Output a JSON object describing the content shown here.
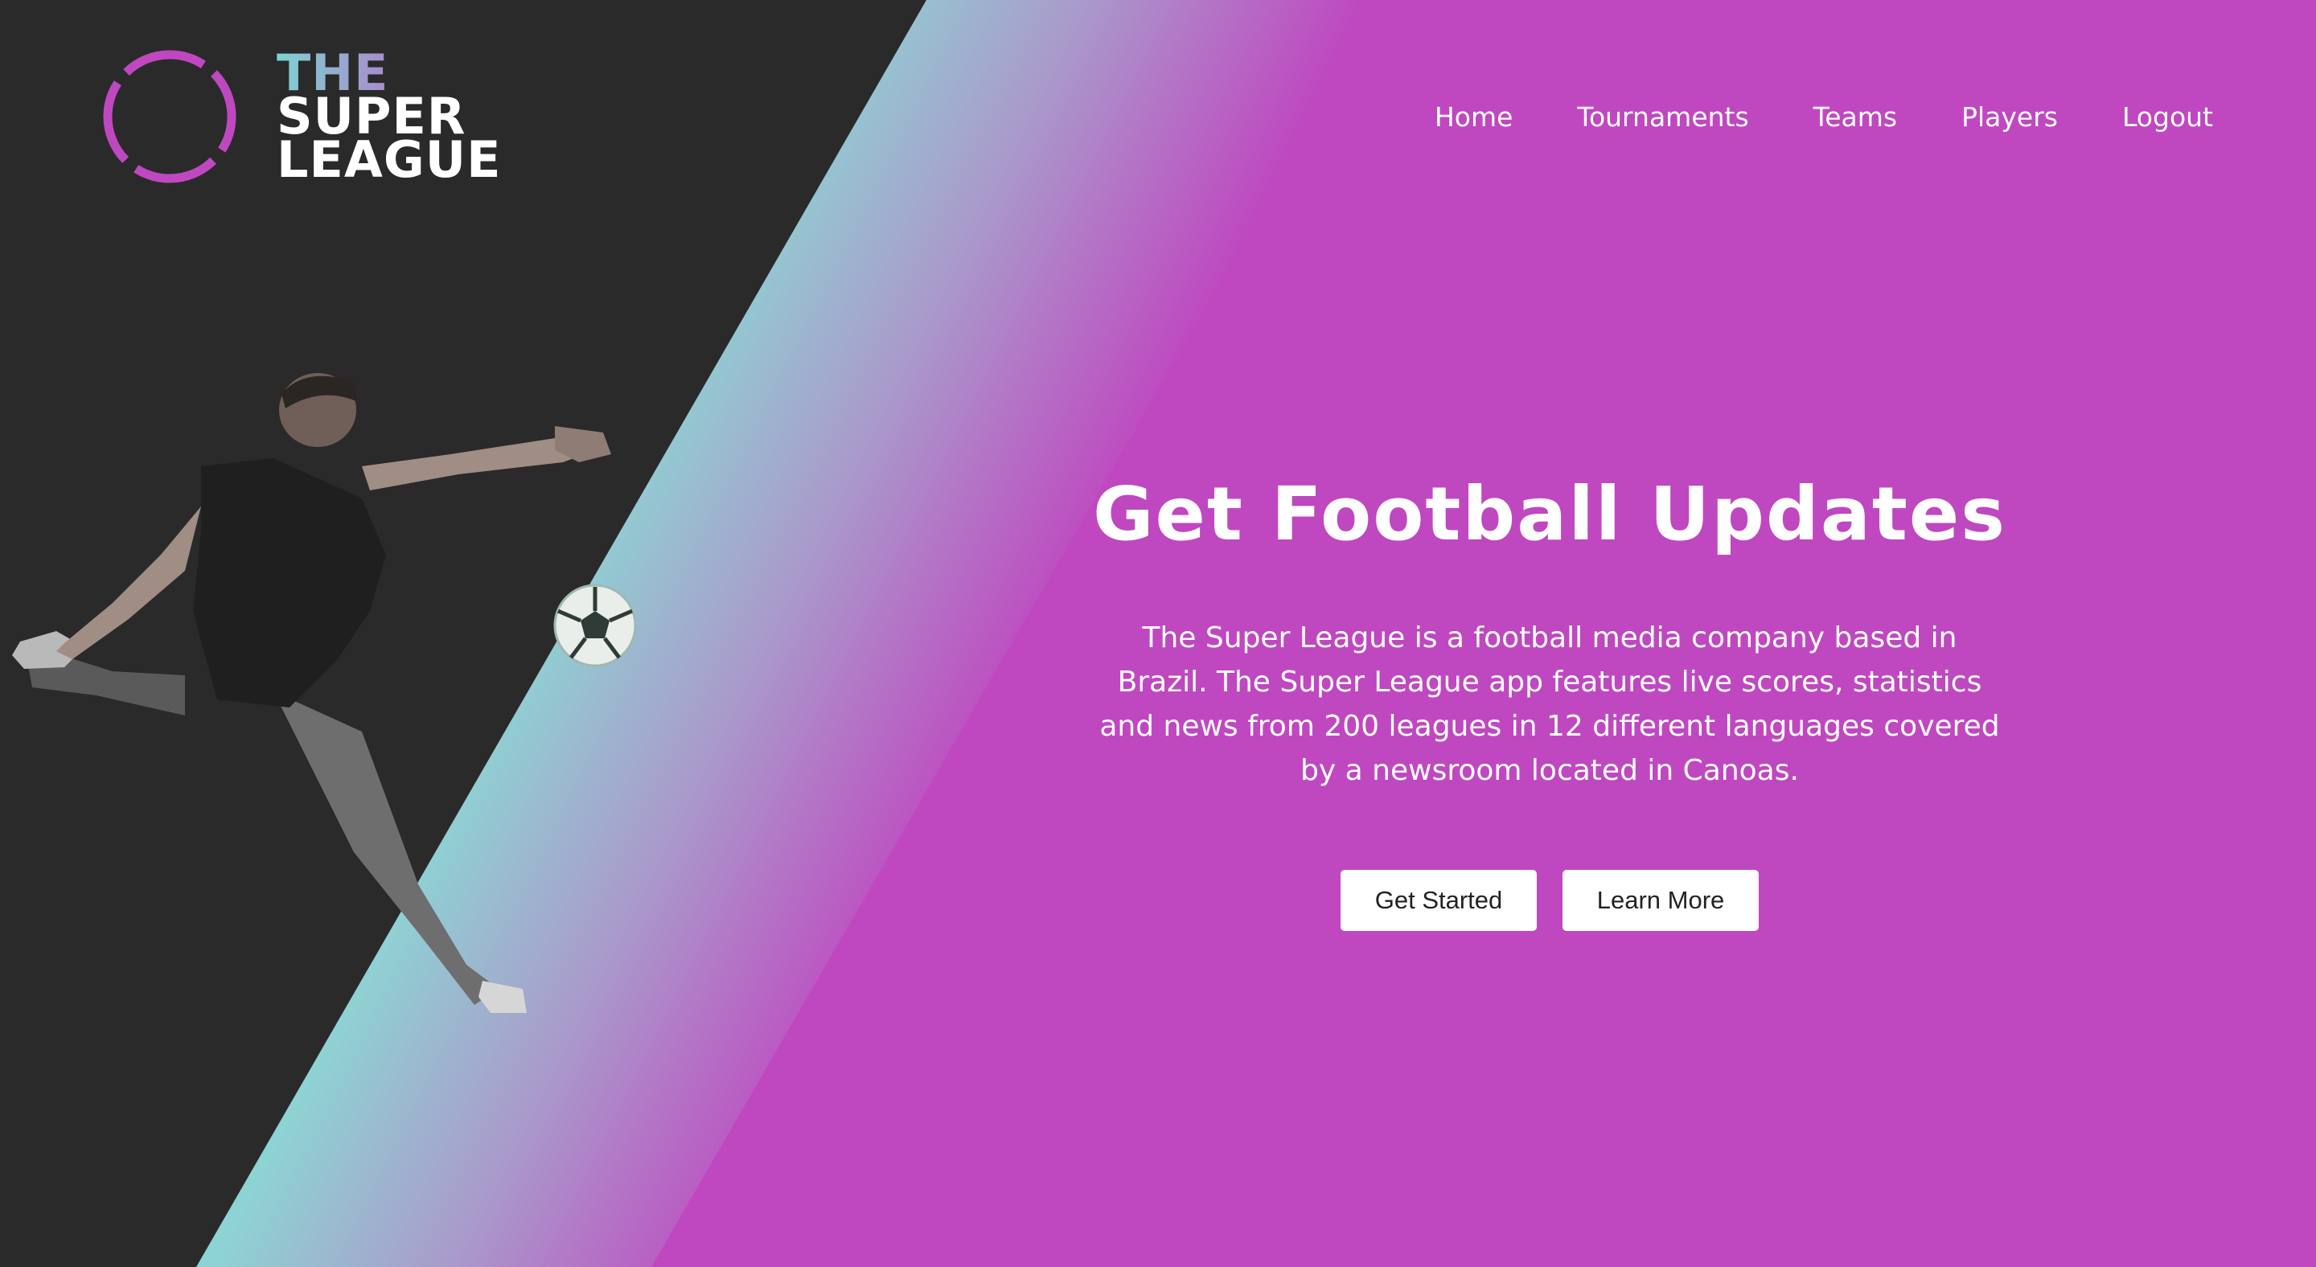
{
  "brand": {
    "line1": "THE",
    "line2": "SUPER",
    "line3": "LEAGUE",
    "ring_color": "#BF48C0"
  },
  "nav": {
    "items": [
      {
        "label": "Home"
      },
      {
        "label": "Tournaments"
      },
      {
        "label": "Teams"
      },
      {
        "label": "Players"
      },
      {
        "label": "Logout"
      }
    ]
  },
  "hero": {
    "title": "Get Football Updates",
    "description": "The Super League is a football media company based in Brazil. The Super League app features live scores, statistics and news from 200 leagues in 12 different languages covered by a newsroom located in Canoas.",
    "primary_button": "Get Started",
    "secondary_button": "Learn More"
  },
  "colors": {
    "background_dark": "#2A2A2A",
    "accent_magenta": "#BF48C0",
    "accent_teal": "#8ED3D3",
    "button_bg": "#FFFFFF",
    "button_text": "#222222"
  },
  "icons": {
    "logo": "ring-logo-icon",
    "ball": "football-icon"
  }
}
